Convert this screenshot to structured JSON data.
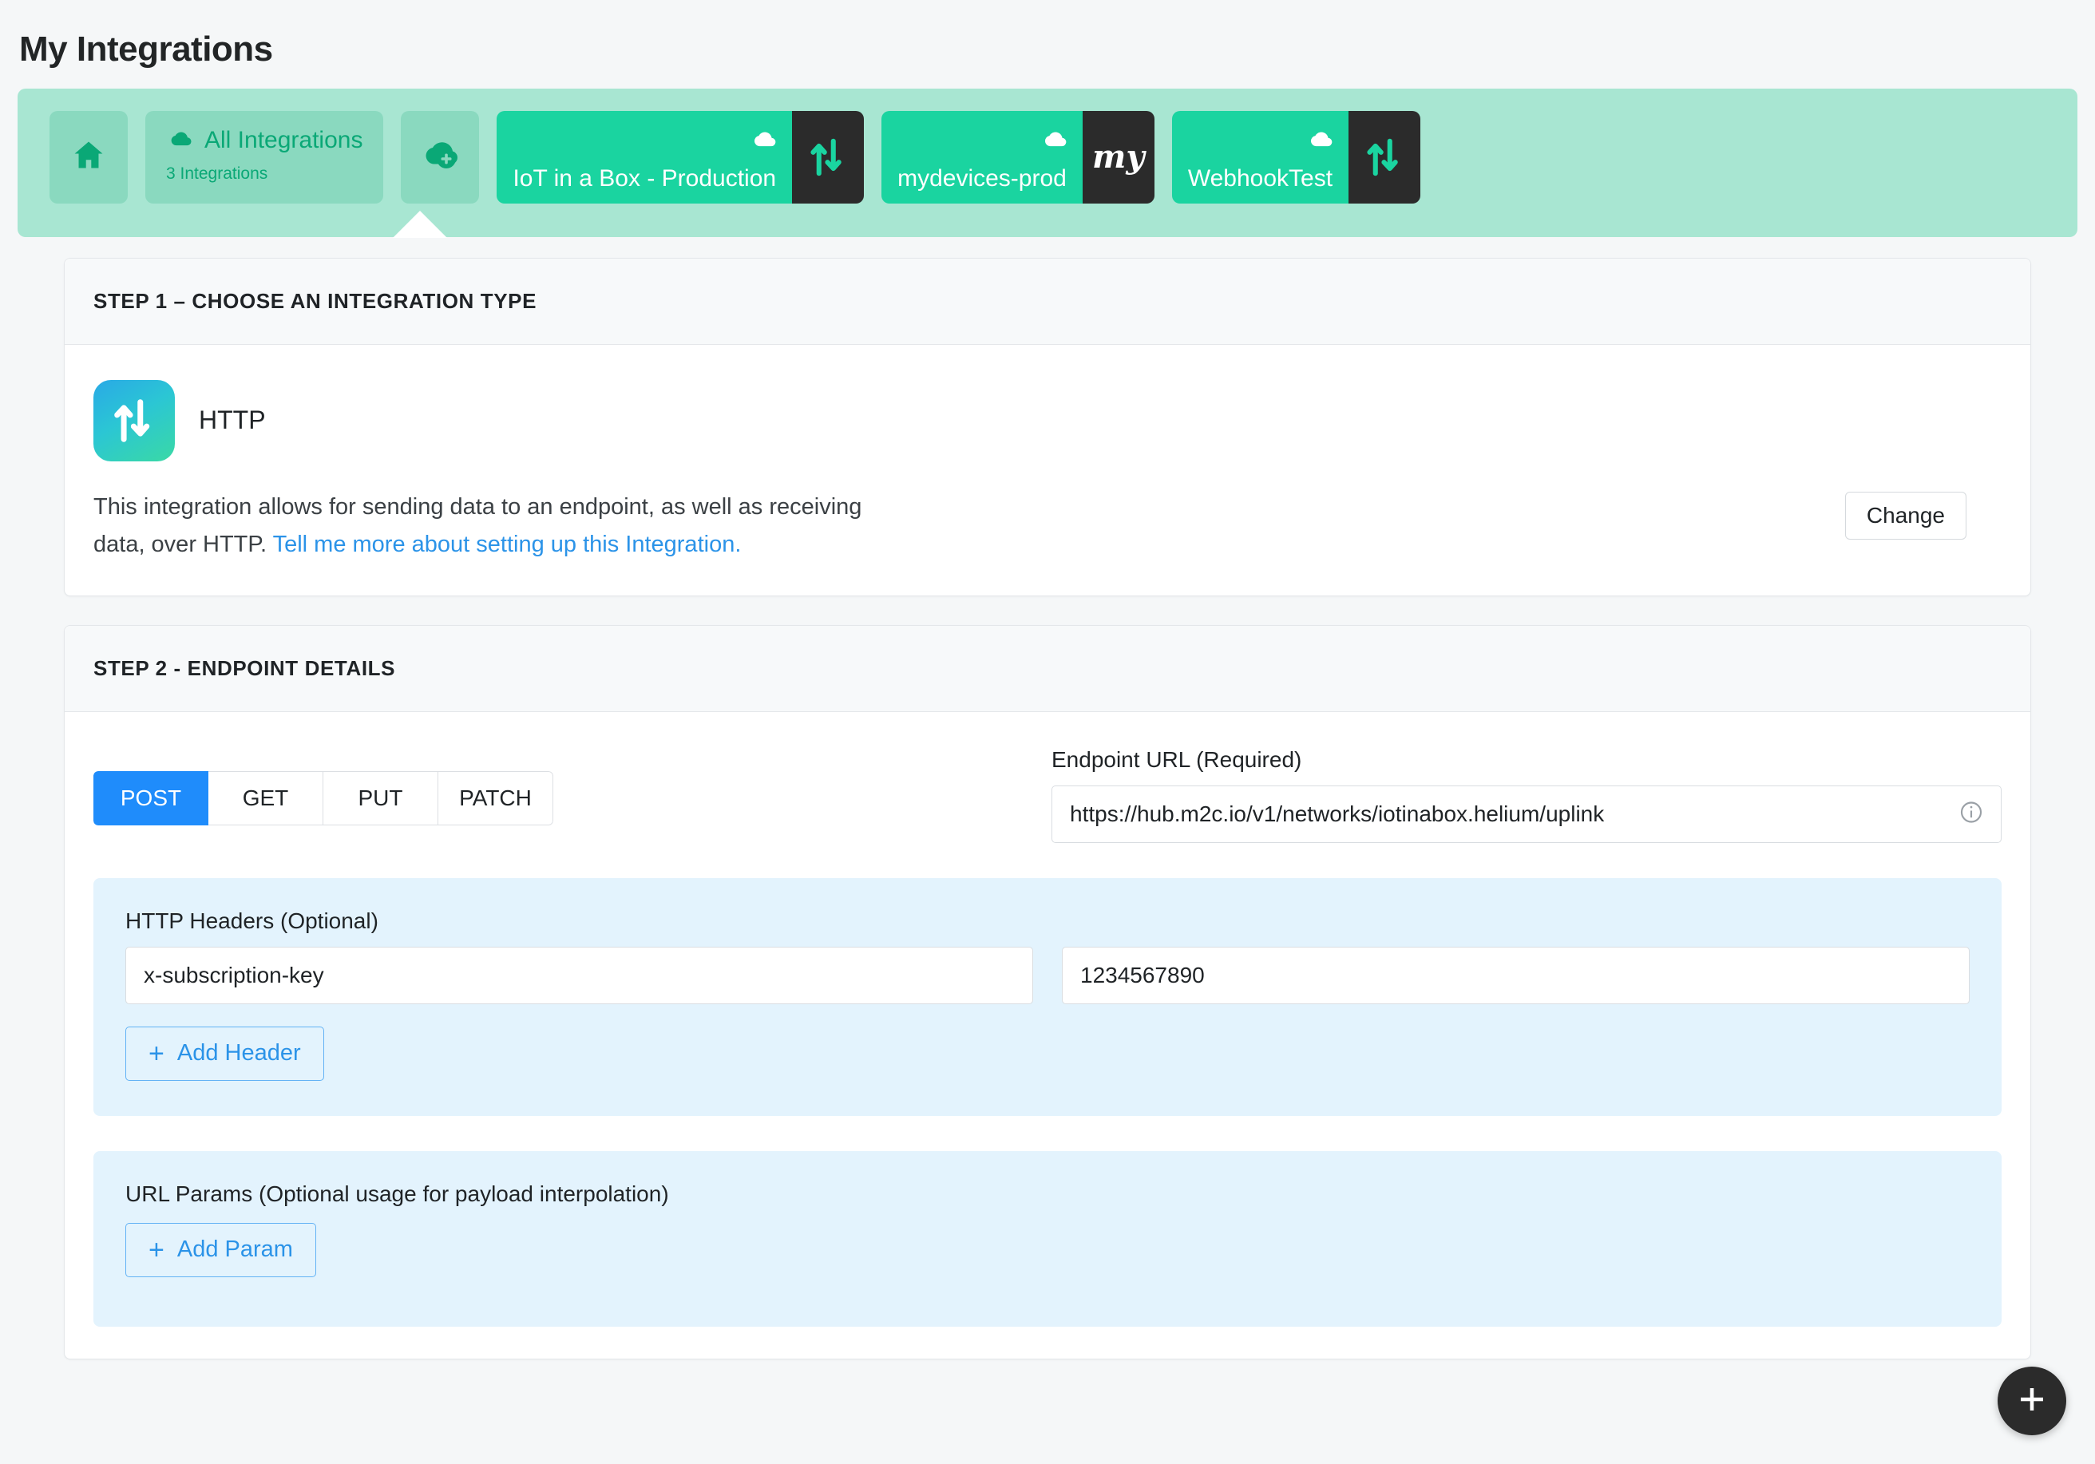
{
  "page": {
    "title": "My Integrations"
  },
  "integrations_bar": {
    "home_button": {
      "icon": "home-icon"
    },
    "all_integrations": {
      "icon": "cloud-icon",
      "title": "All Integrations",
      "subtitle": "3 Integrations"
    },
    "add_integration": {
      "icon": "cloud-plus-icon"
    },
    "chips": [
      {
        "label": "IoT in a Box - Production",
        "cloud_icon": "cloud-icon",
        "logo": "http-arrows-icon"
      },
      {
        "label": "mydevices-prod",
        "cloud_icon": "cloud-icon",
        "logo": "my-script-logo"
      },
      {
        "label": "WebhookTest",
        "cloud_icon": "cloud-icon",
        "logo": "http-arrows-icon"
      }
    ],
    "colors": {
      "bar_background": "#a8e6d2",
      "button_background": "#8ad9bf",
      "chip_green": "#1ad4a0",
      "chip_dark": "#2b2b2b",
      "accent_green": "#0aa876"
    }
  },
  "step1": {
    "header": "STEP 1 – CHOOSE AN INTEGRATION TYPE",
    "type_name": "HTTP",
    "type_icon": "http-arrows-icon",
    "description_text": "This integration allows for sending data to an endpoint, as well as receiving data, over HTTP. ",
    "description_link": "Tell me more about setting up this Integration.",
    "change_label": "Change",
    "link_color": "#2b93e8"
  },
  "step2": {
    "header": "STEP 2 - ENDPOINT DETAILS",
    "methods": [
      {
        "label": "POST",
        "active": true
      },
      {
        "label": "GET",
        "active": false
      },
      {
        "label": "PUT",
        "active": false
      },
      {
        "label": "PATCH",
        "active": false
      }
    ],
    "active_method_color": "#1f8cfb",
    "endpoint": {
      "label": "Endpoint URL (Required)",
      "value": "https://hub.m2c.io/v1/networks/iotinabox.helium/uplink",
      "placeholder": "Endpoint URL",
      "info_icon": "info-circle-icon"
    },
    "headers": {
      "label": "HTTP Headers (Optional)",
      "rows": [
        {
          "key": "x-subscription-key",
          "value": "1234567890"
        }
      ],
      "key_placeholder": "Header",
      "value_placeholder": "Value",
      "add_label": "Add Header",
      "add_icon": "plus-icon"
    },
    "url_params": {
      "label": "URL Params (Optional usage for payload interpolation)",
      "add_label": "Add Param",
      "add_icon": "plus-icon"
    },
    "panel_background": "#e3f3fd"
  },
  "fab": {
    "icon": "plus-icon"
  }
}
